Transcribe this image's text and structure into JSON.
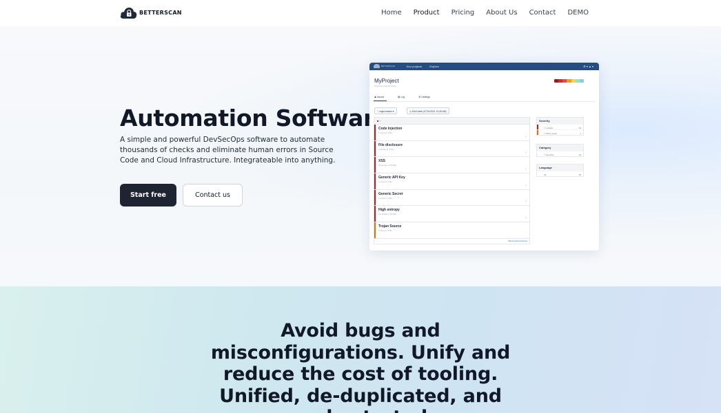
{
  "nav": {
    "brand": "BETTERSCAN",
    "links": [
      {
        "label": "Home"
      },
      {
        "label": "Product",
        "active": true
      },
      {
        "label": "Pricing"
      },
      {
        "label": "About Us"
      },
      {
        "label": "Contact"
      },
      {
        "label": "DEMO"
      }
    ]
  },
  "hero": {
    "title": "Automation Software",
    "description": "A simple and powerful DevSecOps software to automate thousands of checks and eliminate human errors in Source Code and Cloud Infrastructure. Integrateable into anything.",
    "primary_button": "Start free",
    "secondary_button": "Contact us"
  },
  "app_preview": {
    "brand": "BETTERSCAN",
    "top_nav": [
      "Your projects",
      "Explore"
    ],
    "top_right": "⚙ ▾   ▲ ▾",
    "project_title": "MyProject",
    "project_subtitle": "Check for new commits",
    "tabs": [
      "Issues",
      "Log",
      "Settings"
    ],
    "branch": "origin/master",
    "commit": "f19c24eeb (07/31/2021 10:49 AM)",
    "list_header": "■ ›",
    "issues": [
      {
        "title": "Code Injection",
        "subtitle": "1 issue in 1 file.",
        "severity_color": "#b91c1c"
      },
      {
        "title": "File disclosure",
        "subtitle": "4 issues in 3 files.",
        "severity_color": "#b91c1c"
      },
      {
        "title": "XSS",
        "subtitle": "19 issues in 10 files.",
        "severity_color": "#b91c1c"
      },
      {
        "title": "Generic API Key",
        "subtitle": "1 issue in 1 file.",
        "severity_color": "#b91c1c"
      },
      {
        "title": "Generic Secret",
        "subtitle": "1 issue in 1 file.",
        "severity_color": "#b91c1c"
      },
      {
        "title": "High entropy",
        "subtitle": "22 issues in 10 files.",
        "severity_color": "#b91c1c"
      },
      {
        "title": "Trojan Source",
        "subtitle": "1 issue in 1 file.",
        "severity_color": "#d97706"
      }
    ],
    "show_ignored": "Show ignored issues",
    "filters": {
      "severity_title": "Severity",
      "severity": [
        {
          "label": "Critical",
          "count": "33",
          "color": "#b91c1c"
        },
        {
          "label": "Minor Issue",
          "count": "1",
          "color": "#d97706"
        }
      ],
      "category_title": "Category",
      "category": [
        {
          "label": "Security",
          "count": "33"
        }
      ],
      "language_title": "Language",
      "language": [
        {
          "label": "All",
          "count": "56"
        }
      ]
    },
    "severity_bar_colors": [
      "#991b1b",
      "#dc2626",
      "#ef4444",
      "#f59e0b",
      "#fcd34d",
      "#86efac",
      "#93c5fd"
    ]
  },
  "section2": {
    "title": "Avoid bugs and misconfigurations. Unify and reduce the cost of tooling. Unified, de-duplicated, and orchestrated"
  }
}
